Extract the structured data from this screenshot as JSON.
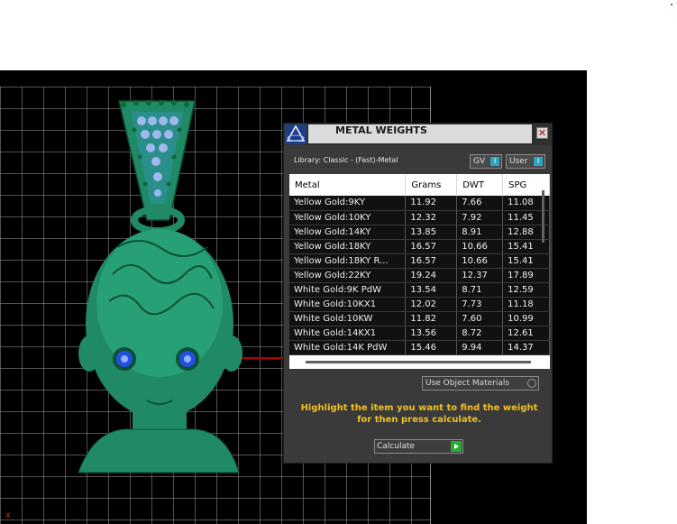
{
  "panel": {
    "title": "METAL WEIGHTS",
    "library": "Library: Classic - (Fast)-Metal",
    "toggles": [
      {
        "label": "GV",
        "indicator": "I"
      },
      {
        "label": "User",
        "indicator": "I"
      }
    ],
    "table": {
      "headers": [
        "Metal",
        "Grams",
        "DWT",
        "SPG"
      ],
      "rows": [
        [
          "Yellow Gold:9KY",
          "11.92",
          "7.66",
          "11.08"
        ],
        [
          "Yellow Gold:10KY",
          "12.32",
          "7.92",
          "11.45"
        ],
        [
          "Yellow Gold:14KY",
          "13.85",
          "8.91",
          "12.88"
        ],
        [
          "Yellow Gold:18KY",
          "16.57",
          "10.66",
          "15.41"
        ],
        [
          "Yellow Gold:18KY R...",
          "16.57",
          "10.66",
          "15.41"
        ],
        [
          "Yellow Gold:22KY",
          "19.24",
          "12.37",
          "17.89"
        ],
        [
          "White Gold:9K PdW",
          "13.54",
          "8.71",
          "12.59"
        ],
        [
          "White Gold:10KX1",
          "12.02",
          "7.73",
          "11.18"
        ],
        [
          "White Gold:10KW",
          "11.82",
          "7.60",
          "10.99"
        ],
        [
          "White Gold:14KX1",
          "13.56",
          "8.72",
          "12.61"
        ],
        [
          "White Gold:14K PdW",
          "15.46",
          "9.94",
          "14.37"
        ]
      ]
    },
    "dropdown_label": "Use Object Materials",
    "instructions_line1": "Highlight the item you want to find the weight",
    "instructions_line2": "for then press calculate.",
    "calculate_label": "Calculate",
    "close_glyph": "✕"
  },
  "viewport": {
    "corner_mark": "x"
  },
  "colors": {
    "model_green": "#1f8a65",
    "highlight_text": "#f0c020",
    "gem_blue": "#2050e0"
  }
}
